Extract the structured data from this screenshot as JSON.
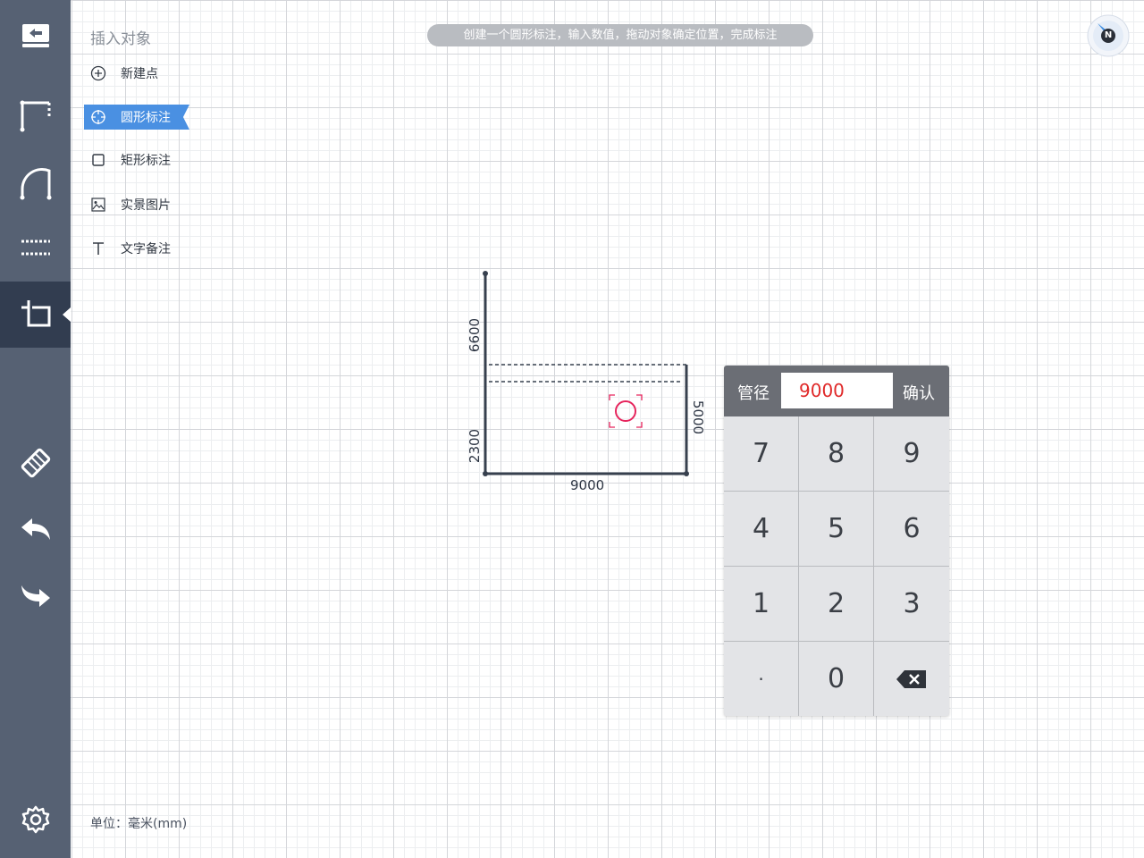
{
  "panel": {
    "title": "插入对象",
    "items": [
      {
        "label": "新建点",
        "icon": "plus-circle-icon"
      },
      {
        "label": "圆形标注",
        "icon": "crosshair-icon"
      },
      {
        "label": "矩形标注",
        "icon": "square-icon"
      },
      {
        "label": "实景图片",
        "icon": "image-icon"
      },
      {
        "label": "文字备注",
        "icon": "text-icon"
      }
    ],
    "selected_index": 1
  },
  "hint": "创建一个圆形标注，输入数值，拖动对象确定位置，完成标注",
  "compass": {
    "label": "N"
  },
  "drawing": {
    "dimensions": {
      "left_upper": "6600",
      "left_lower": "2300",
      "right": "5000",
      "bottom": "9000"
    },
    "marker_color": "#e6245c"
  },
  "keypad": {
    "label": "管径",
    "value": "9000",
    "confirm": "确认",
    "keys": [
      "7",
      "8",
      "9",
      "4",
      "5",
      "6",
      "1",
      "2",
      "3",
      "·",
      "0",
      "backspace-icon"
    ]
  },
  "unit": "单位：毫米(mm)",
  "colors": {
    "toolbar": "#566173",
    "toolbar_active": "#323d50",
    "accent": "#4a90e2",
    "value": "#e02a2a"
  }
}
